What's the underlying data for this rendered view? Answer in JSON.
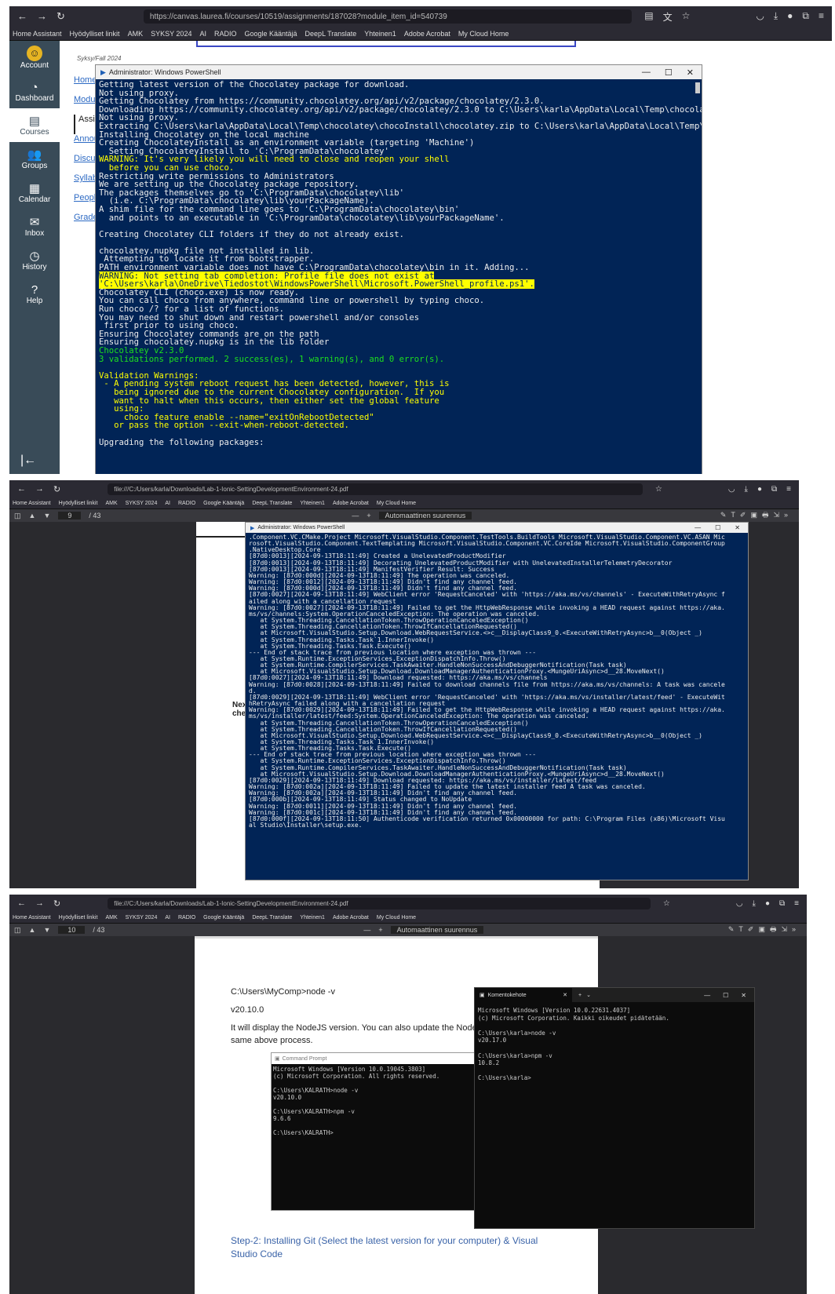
{
  "shot1": {
    "url": "https://canvas.laurea.fi/courses/10519/assignments/187028?module_item_id=540739",
    "bookmarks": [
      "Home Assistant",
      "Hyödylliset linkit",
      "AMK",
      "SYKSY 2024",
      "AI",
      "RADIO",
      "Google Kääntäjä",
      "DeepL Translate",
      "Yhteinen1",
      "Adobe Acrobat",
      "My Cloud Home"
    ],
    "canvas_nav": [
      {
        "icon": "account-icon",
        "label": "Account"
      },
      {
        "icon": "dashboard-icon",
        "label": "Dashboard"
      },
      {
        "icon": "courses-icon",
        "label": "Courses"
      },
      {
        "icon": "groups-icon",
        "label": "Groups"
      },
      {
        "icon": "calendar-icon",
        "label": "Calendar"
      },
      {
        "icon": "inbox-icon",
        "label": "Inbox"
      },
      {
        "icon": "history-icon",
        "label": "History"
      },
      {
        "icon": "help-icon",
        "label": "Help"
      }
    ],
    "term": "Syksy/Fall 2024",
    "course_nav": [
      "Home",
      "Modules",
      "Assignments",
      "Announcements",
      "Discussions",
      "Syllabus",
      "People",
      "Grades"
    ],
    "ps_title": "Administrator: Windows PowerShell",
    "ps_lines": [
      [
        "n",
        "Getting latest version of the Chocolatey package for download."
      ],
      [
        "n",
        "Not using proxy."
      ],
      [
        "n",
        "Getting Chocolatey from https://community.chocolatey.org/api/v2/package/chocolatey/2.3.0."
      ],
      [
        "n",
        "Downloading https://community.chocolatey.org/api/v2/package/chocolatey/2.3.0 to C:\\Users\\karla\\AppData\\Local\\Temp\\chocolatey\\chocoInstall\\chocolatey.zip"
      ],
      [
        "n",
        "Not using proxy."
      ],
      [
        "n",
        "Extracting C:\\Users\\karla\\AppData\\Local\\Temp\\chocolatey\\chocoInstall\\chocolatey.zip to C:\\Users\\karla\\AppData\\Local\\Temp\\chocolatey\\chocoInstall"
      ],
      [
        "n",
        "Installing Chocolatey on the local machine"
      ],
      [
        "n",
        "Creating ChocolateyInstall as an environment variable (targeting 'Machine')"
      ],
      [
        "n",
        "  Setting ChocolateyInstall to 'C:\\ProgramData\\chocolatey'"
      ],
      [
        "w",
        "WARNING: It's very likely you will need to close and reopen your shell"
      ],
      [
        "w",
        "  before you can use choco."
      ],
      [
        "n",
        "Restricting write permissions to Administrators"
      ],
      [
        "n",
        "We are setting up the Chocolatey package repository."
      ],
      [
        "n",
        "The packages themselves go to 'C:\\ProgramData\\chocolatey\\lib'"
      ],
      [
        "n",
        "  (i.e. C:\\ProgramData\\chocolatey\\lib\\yourPackageName)."
      ],
      [
        "n",
        "A shim file for the command line goes to 'C:\\ProgramData\\chocolatey\\bin'"
      ],
      [
        "n",
        "  and points to an executable in 'C:\\ProgramData\\chocolatey\\lib\\yourPackageName'."
      ],
      [
        "n",
        ""
      ],
      [
        "n",
        "Creating Chocolatey CLI folders if they do not already exist."
      ],
      [
        "n",
        ""
      ],
      [
        "n",
        "chocolatey.nupkg file not installed in lib."
      ],
      [
        "n",
        " Attempting to locate it from bootstrapper."
      ],
      [
        "n",
        "PATH environment variable does not have C:\\ProgramData\\chocolatey\\bin in it. Adding..."
      ],
      [
        "h",
        "WARNING: Not setting tab completion: Profile file does not exist at"
      ],
      [
        "h",
        "'C:\\Users\\karla\\OneDrive\\Tiedostot\\WindowsPowerShell\\Microsoft.PowerShell_profile.ps1'."
      ],
      [
        "n",
        "Chocolatey CLI (choco.exe) is now ready."
      ],
      [
        "n",
        "You can call choco from anywhere, command line or powershell by typing choco."
      ],
      [
        "n",
        "Run choco /? for a list of functions."
      ],
      [
        "n",
        "You may need to shut down and restart powershell and/or consoles"
      ],
      [
        "n",
        " first prior to using choco."
      ],
      [
        "n",
        "Ensuring Chocolatey commands are on the path"
      ],
      [
        "n",
        "Ensuring chocolatey.nupkg is in the lib folder"
      ],
      [
        "g",
        "Chocolatey v2.3.0"
      ],
      [
        "g",
        "3 validations performed. 2 success(es), 1 warning(s), and 0 error(s)."
      ],
      [
        "n",
        ""
      ],
      [
        "w",
        "Validation Warnings:"
      ],
      [
        "w",
        " - A pending system reboot request has been detected, however, this is"
      ],
      [
        "w",
        "   being ignored due to the current Chocolatey configuration.  If you"
      ],
      [
        "w",
        "   want to halt when this occurs, then either set the global feature"
      ],
      [
        "w",
        "   using:"
      ],
      [
        "w",
        "     choco feature enable --name=\"exitOnRebootDetected\""
      ],
      [
        "w",
        "   or pass the option --exit-when-reboot-detected."
      ],
      [
        "n",
        ""
      ],
      [
        "n",
        "Upgrading the following packages:"
      ]
    ]
  },
  "shot2": {
    "url": "file:///C:/Users/karla/Downloads/Lab-1-Ionic-SettingDevelopmentEnvironment-24.pdf",
    "page": "9",
    "pages": "/ 43",
    "zoom": "Automaattinen suurennus",
    "ps_title": "Administrator: Windows PowerShell",
    "ps_text": ".Component.VC.CMake.Project Microsoft.VisualStudio.Component.TestTools.BuildTools Microsoft.VisualStudio.Component.VC.ASAN Mic\nrosoft.VisualStudio.Component.TextTemplating Microsoft.VisualStudio.Component.VC.CoreIde Microsoft.VisualStudio.ComponentGroup\n.NativeDesktop.Core\n[87d0:0013][2024-09-13T18:11:49] Created a UnelevatedProductModifier\n[87d0:0013][2024-09-13T18:11:49] Decorating UnelevatedProductModifier with UnelevatedInstallerTelemetryDecorator\n[87d0:0013][2024-09-13T18:11:49] ManifestVerifier Result: Success\nWarning: [87d0:000d][2024-09-13T18:11:49] The operation was canceled.\nWarning: [87d0:0012][2024-09-13T18:11:49] Didn't find any channel feed.\nWarning: [87d0:000d][2024-09-13T18:11:49] Didn't find any channel feed.\n[87d0:0027][2024-09-13T18:11:49] WebClient error 'RequestCanceled' with 'https://aka.ms/vs/channels' - ExecuteWithRetryAsync f\nailed along with a cancellation request\nWarning: [87d0:0027][2024-09-13T18:11:49] Failed to get the HttpWebResponse while invoking a HEAD request against https://aka.\nms/vs/channels:System.OperationCanceledException: The operation was canceled.\n   at System.Threading.CancellationToken.ThrowOperationCanceledException()\n   at System.Threading.CancellationToken.ThrowIfCancellationRequested()\n   at Microsoft.VisualStudio.Setup.Download.WebRequestService.<>c__DisplayClass9_0.<ExecuteWithRetryAsync>b__0(Object _)\n   at System.Threading.Tasks.Task`1.InnerInvoke()\n   at System.Threading.Tasks.Task.Execute()\n--- End of stack trace from previous location where exception was thrown ---\n   at System.Runtime.ExceptionServices.ExceptionDispatchInfo.Throw()\n   at System.Runtime.CompilerServices.TaskAwaiter.HandleNonSuccessAndDebuggerNotification(Task task)\n   at Microsoft.VisualStudio.Setup.Download.DownloadManagerAuthenticationProxy.<MungeUriAsync>d__28.MoveNext()\n[87d0:0027][2024-09-13T18:11:49] Download requested: https://aka.ms/vs/channels\nWarning: [87d0:0028][2024-09-13T18:11:49] Failed to download channels file from https://aka.ms/vs/channels: A task was cancele\nd.\n[87d0:0029][2024-09-13T18:11:49] WebClient error 'RequestCanceled' with 'https://aka.ms/vs/installer/latest/feed' - ExecuteWit\nhRetryAsync failed along with a cancellation request\nWarning: [87d0:0029][2024-09-13T18:11:49] Failed to get the HttpWebResponse while invoking a HEAD request against https://aka.\nms/vs/installer/latest/feed:System.OperationCanceledException: The operation was canceled.\n   at System.Threading.CancellationToken.ThrowOperationCanceledException()\n   at System.Threading.CancellationToken.ThrowIfCancellationRequested()\n   at Microsoft.VisualStudio.Setup.Download.WebRequestService.<>c__DisplayClass9_0.<ExecuteWithRetryAsync>b__0(Object _)\n   at System.Threading.Tasks.Task`1.InnerInvoke()\n   at System.Threading.Tasks.Task.Execute()\n--- End of stack trace from previous location where exception was thrown ---\n   at System.Runtime.ExceptionServices.ExceptionDispatchInfo.Throw()\n   at System.Runtime.CompilerServices.TaskAwaiter.HandleNonSuccessAndDebuggerNotification(Task task)\n   at Microsoft.VisualStudio.Setup.Download.DownloadManagerAuthenticationProxy.<MungeUriAsync>d__28.MoveNext()\n[87d0:0029][2024-09-13T18:11:49] Download requested: https://aka.ms/vs/installer/latest/feed\nWarning: [87d0:002a][2024-09-13T18:11:49] Failed to update the latest installer feed A task was canceled.\nWarning: [87d0:002a][2024-09-13T18:11:49] Didn't find any channel feed.\n[87d0:000b][2024-09-13T18:11:49] Status changed to NoUpdate\nWarning: [87d0:0011][2024-09-13T18:11:49] Didn't find any channel feed.\nWarning: [87d0:001c][2024-09-13T18:11:49] Didn't find any channel feed.\n[87d0:000f][2024-09-13T18:11:50] Authenticode verification returned 0x00000000 for path: C:\\Program Files (x86)\\Microsoft Visu\nal Studio\\Installer\\setup.exe.",
    "behind_text": "Nex\nche"
  },
  "shot3": {
    "url": "file:///C:/Users/karla/Downloads/Lab-1-Ionic-SettingDevelopmentEnvironment-24.pdf",
    "page": "10",
    "pages": "/ 43",
    "zoom": "Automaattinen suurennus",
    "cmd1": "C:\\Users\\MyComp>node -v",
    "ver1": "v20.10.0",
    "para": "It will display the NodeJS version. You can also update the Node.",
    "para2": "same above process.",
    "cmdprompt_title": "Command Prompt",
    "cmdprompt_text": "Microsoft Windows [Version 10.0.19045.3803]\n(c) Microsoft Corporation. All rights reserved.\n\nC:\\Users\\KALRATH>node -v\nv20.10.0\n\nC:\\Users\\KALRATH>npm -v\n9.6.6\n\nC:\\Users\\KALRATH>",
    "term_tab": "Komentokehote",
    "term_text": "Microsoft Windows [Version 10.0.22631.4037]\n(c) Microsoft Corporation. Kaikki oikeudet pidätetään.\n\nC:\\Users\\karla>node -v\nv20.17.0\n\nC:\\Users\\karla>npm -v\n10.8.2\n\nC:\\Users\\karla>",
    "step": "Step-2: Installing Git (Select the latest version for your computer) & Visual Studio Code"
  }
}
